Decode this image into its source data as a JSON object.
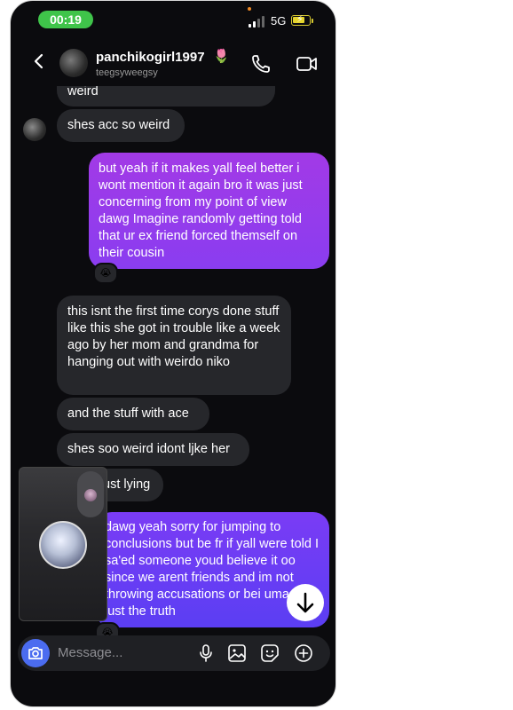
{
  "status": {
    "time": "00:19",
    "network": "5G"
  },
  "header": {
    "name": "panchikogirl1997",
    "username": "teegsyweegsy",
    "name_emoji": "🌷"
  },
  "messages": [
    {
      "text": "weird"
    },
    {
      "text": "shes acc so weird"
    },
    {
      "text": "but yeah if it makes yall feel better i wont mention it again bro it was just concerning from my point of view dawg Imagine randomly getting told that ur ex friend forced themself on their cousin"
    },
    {
      "text": "this isnt the first time corys done stuff like this she got in trouble like a week ago by her mom and grandma for hanging out with weirdo niko"
    },
    {
      "text": "and the stuff with ace"
    },
    {
      "text": "shes soo weird idont ljke her"
    },
    {
      "text": "ust lying"
    },
    {
      "text": "dawg yeah sorry for jumping to conclusions but be fr if yall were told I sa'ed someone youd believe it oo since we arent friends and im not throwing accusations or bei umass its just the truth"
    }
  ],
  "reactions": [
    "😭",
    "😭"
  ],
  "composer": {
    "placeholder": "Message..."
  },
  "colors": {
    "accent": "#4b6cf0",
    "outgoing_top": "#a23ae6",
    "outgoing_bottom": "#5b3ef3",
    "incoming": "#26272b",
    "time_pill": "#3fc44a"
  }
}
